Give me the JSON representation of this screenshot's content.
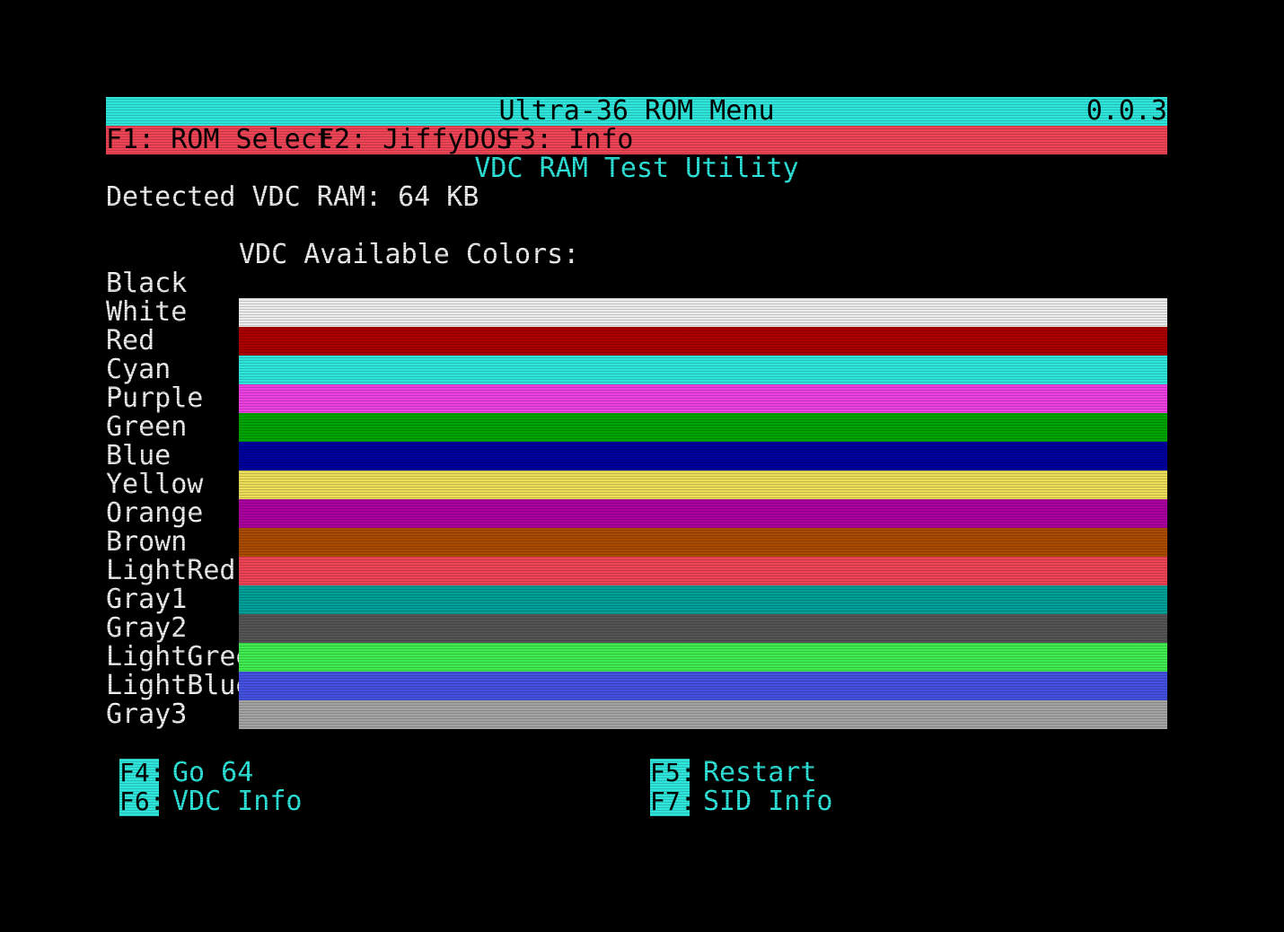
{
  "header": {
    "title": "Ultra-36 ROM Menu",
    "version": "0.0.3",
    "menu": [
      {
        "label": "F1: ROM Select"
      },
      {
        "label": "F2: JiffyDOS"
      },
      {
        "label": "F3: Info"
      }
    ]
  },
  "main": {
    "subtitle": "VDC RAM Test Utility",
    "detected_ram": "Detected VDC RAM: 64 KB",
    "colors_heading": "VDC Available Colors:",
    "colors": [
      {
        "name": "Black",
        "hex": "#000000"
      },
      {
        "name": "White",
        "hex": "#ececec"
      },
      {
        "name": "Red",
        "hex": "#aa0000"
      },
      {
        "name": "Cyan",
        "hex": "#2ee6dc"
      },
      {
        "name": "Purple",
        "hex": "#ec40e2"
      },
      {
        "name": "Green",
        "hex": "#00a400"
      },
      {
        "name": "Blue",
        "hex": "#00009c"
      },
      {
        "name": "Yellow",
        "hex": "#ecde58"
      },
      {
        "name": "Orange",
        "hex": "#aa00a0"
      },
      {
        "name": "Brown",
        "hex": "#aa4c00"
      },
      {
        "name": "LightRed",
        "hex": "#ee4455"
      },
      {
        "name": "Gray1",
        "hex": "#00a098"
      },
      {
        "name": "Gray2",
        "hex": "#545454"
      },
      {
        "name": "LightGreen",
        "hex": "#40ec50"
      },
      {
        "name": "LightBlue",
        "hex": "#4450e0"
      },
      {
        "name": "Gray3",
        "hex": "#a4a4a4"
      }
    ]
  },
  "footer": {
    "options": [
      {
        "key": "F4:",
        "label": "Go 64"
      },
      {
        "key": "F6:",
        "label": "VDC Info"
      },
      {
        "key": "F5:",
        "label": "Restart"
      },
      {
        "key": "F7:",
        "label": "SID Info"
      }
    ]
  },
  "theme": {
    "background": "#000000",
    "title_bar": "#2ee6dc",
    "menu_bar": "#ee4455",
    "text_primary": "#f0f0f0",
    "text_accent": "#2ee6dc"
  }
}
